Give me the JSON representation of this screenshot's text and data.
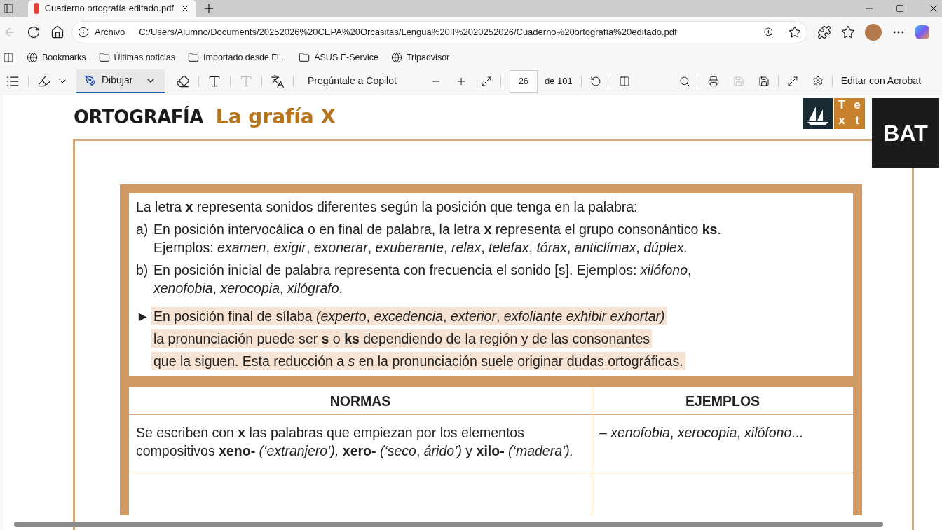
{
  "tab": {
    "title": "Cuaderno ortografía editado.pdf"
  },
  "address": {
    "label": "Archivo",
    "url": "C:/Users/Alumno/Documents/20252026%20CEPA%20Orcasitas/Lengua%20II%2020252026/Cuaderno%20ortografía%20editado.pdf"
  },
  "bookmarks": [
    {
      "kind": "globe",
      "label": "Bookmarks"
    },
    {
      "kind": "folder",
      "label": "Últimas noticias"
    },
    {
      "kind": "folder",
      "label": "Importado desde Fi..."
    },
    {
      "kind": "folder",
      "label": "ASUS E-Service"
    },
    {
      "kind": "globe",
      "label": "Tripadvisor"
    }
  ],
  "pdf_toolbar": {
    "draw": {
      "label": "Dibujar",
      "selected": true
    },
    "copilot": "Pregúntale a Copilot",
    "page": "26",
    "page_total": "de 101",
    "edit": "Editar con Acrobat"
  },
  "page": {
    "heading": "ORTOGRAFÍA",
    "subheading": "La grafía X",
    "logo_text": [
      "T",
      "e",
      "x",
      "t"
    ],
    "badge": "BAT",
    "intro": "La letra **x** representa sonidos diferentes según la posición que tenga en la palabra:",
    "items": [
      {
        "marker": "a)",
        "text": "En posición intervocálica o en final de palabra, la letra **x** representa el grupo consonántico **ks**.",
        "continuation": "Ejemplos: *examen*, *exigir*, *exonerar*, *exuberante*, *relax*, *telefax*, *tórax*, *anticlímax*, *dúplex.*"
      },
      {
        "marker": "b)",
        "text": "En posición inicial de palabra representa con frecuencia el sonido [s]. Ejemplos: *xilófono*,",
        "continuation": "*xenofobia*, *xerocopia*, *xilógrafo*."
      }
    ],
    "note": {
      "marker": "►",
      "lines": [
        "En posición final de sílaba *(experto*, *excedencia*, *exterior*, *exfoliante exhibir exhortar)*",
        "la pronunciación puede ser **s** o **ks** dependiendo de la región y de las consonantes",
        "que la siguen. Esta reducción a *s* en la pronunciación suele originar dudas ortográficas."
      ]
    },
    "table": {
      "columns": [
        "NORMAS",
        "EJEMPLOS"
      ],
      "rows": [
        {
          "norma": "Se escriben con **x** las palabras que empiezan por los elementos compositivos **xeno-** *(‘extranjero’),* **xero-** *(‘seco*, *árido’)* y **xilo-** *(‘madera’).*",
          "ejemplos": "– *xenofobia*, *xerocopia*, *xilófono*..."
        }
      ]
    }
  }
}
